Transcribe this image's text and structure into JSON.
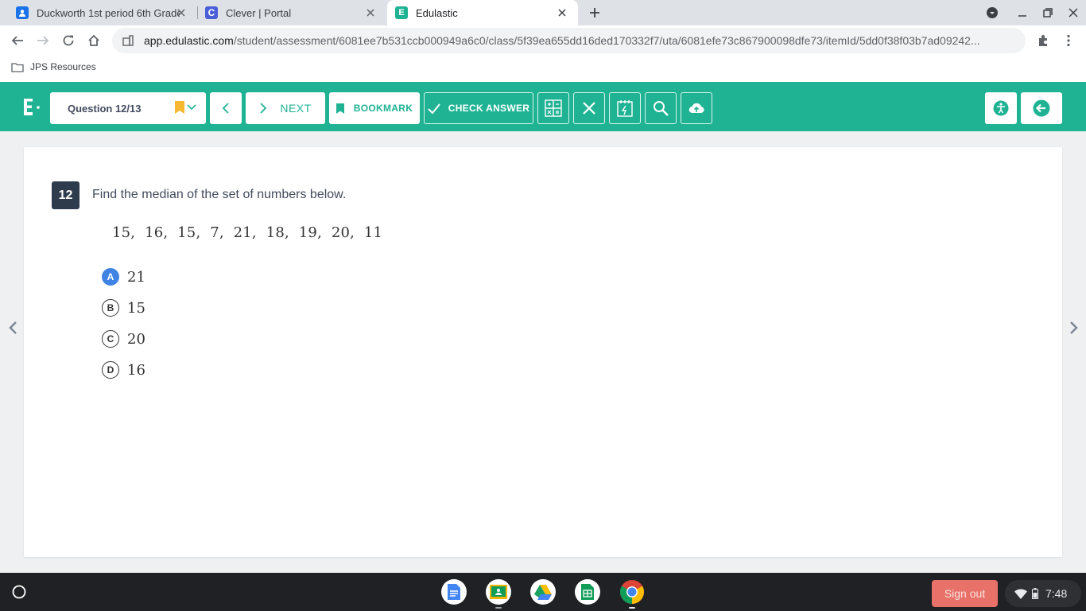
{
  "browser": {
    "tabs": [
      {
        "title": "Duckworth 1st period 6th Grade",
        "active": false
      },
      {
        "title": "Clever | Portal",
        "active": false
      },
      {
        "title": "Edulastic",
        "active": true
      }
    ],
    "url_host": "app.edulastic.com",
    "url_path": "/student/assessment/6081ee7b531ccb000949a6c0/class/5f39ea655dd16ded170332f7/uta/6081efe73c867900098dfe73/itemId/5dd0f38f03b7ad09242...",
    "bookmarks": [
      "JPS Resources"
    ]
  },
  "app": {
    "brand_color": "#1fb394",
    "question_select": "Question 12/13",
    "next_label": "NEXT",
    "bookmark_label": "BOOKMARK",
    "check_answer_label": "CHECK ANSWER",
    "tools": [
      "calculator-icon",
      "close-icon",
      "scratchpad-icon",
      "magnifier-icon",
      "cloud-upload-icon"
    ],
    "right_buttons": [
      "accessibility-icon",
      "exit-icon"
    ]
  },
  "question": {
    "number": "12",
    "stem": "Find the median of the set of numbers below.",
    "numbers": "15,  16,  15,  7,  21,  18,  19,  20,  11",
    "options": [
      {
        "letter": "A",
        "value": "21",
        "selected": true
      },
      {
        "letter": "B",
        "value": "15",
        "selected": false
      },
      {
        "letter": "C",
        "value": "20",
        "selected": false
      },
      {
        "letter": "D",
        "value": "16",
        "selected": false
      }
    ]
  },
  "shelf": {
    "apps": [
      "google-docs",
      "google-classroom",
      "google-drive",
      "google-sheets",
      "chrome"
    ],
    "sign_out_label": "Sign out",
    "time": "7:48"
  }
}
